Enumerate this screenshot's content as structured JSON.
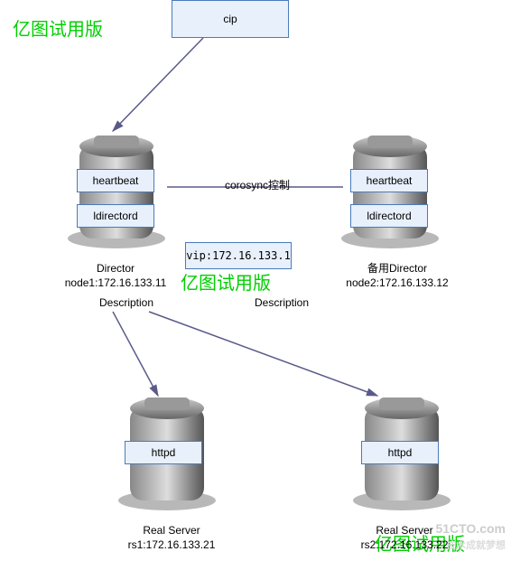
{
  "watermark": "亿图试用版",
  "site_wm": "51CTO.com",
  "site_wm2": "技术成就梦想",
  "cip": {
    "label": "cip"
  },
  "director": {
    "services": {
      "hb": "heartbeat",
      "ld": "ldirectord"
    },
    "caption_line1": "Director",
    "caption_line2": "node1:172.16.133.11"
  },
  "backup": {
    "services": {
      "hb": "heartbeat",
      "ld": "ldirectord"
    },
    "caption_line1": "备用Director",
    "caption_line2": "node2:172.16.133.12"
  },
  "link_center": "corosync控制",
  "vip": "vip:172.16.133.1",
  "desc": "Description",
  "rs1": {
    "service": "httpd",
    "caption_line1": "Real Server",
    "caption_line2": "rs1:172.16.133.21"
  },
  "rs2": {
    "service": "httpd",
    "caption_line1": "Real Server",
    "caption_line2": "rs2:172.16.133.22"
  }
}
